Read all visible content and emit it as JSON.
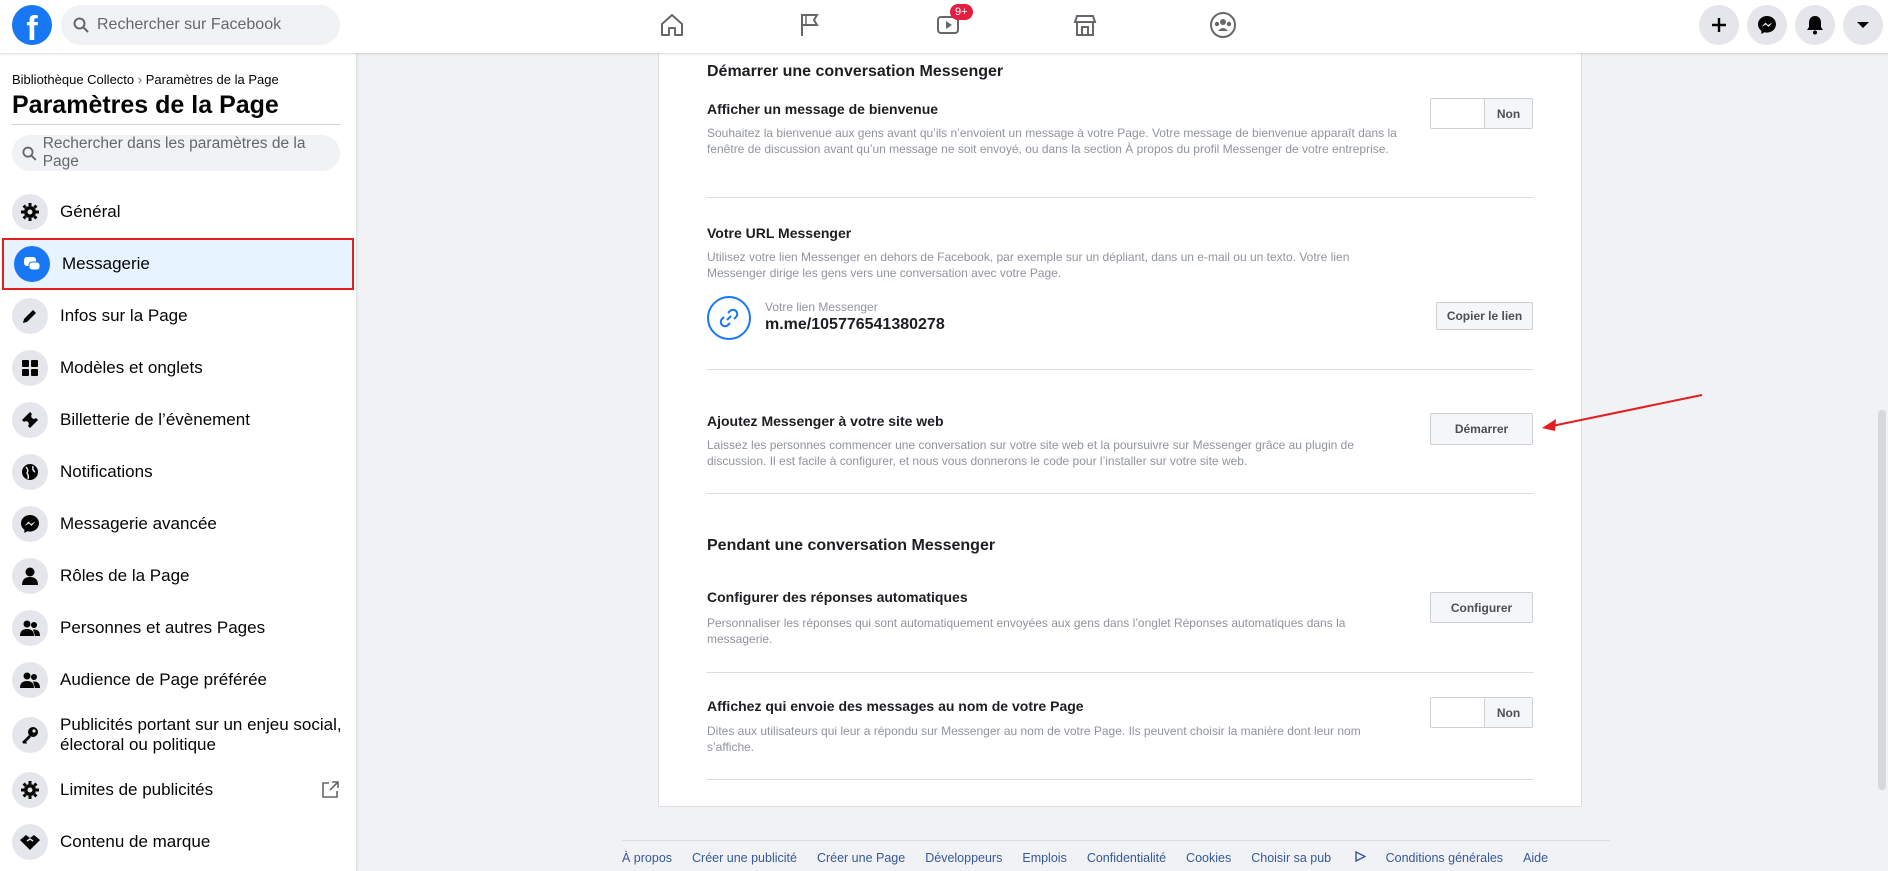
{
  "topbar": {
    "logo": "f",
    "search_placeholder": "Rechercher sur Facebook",
    "video_badge": "9+"
  },
  "sidebar": {
    "breadcrumb_page": "Bibliothèque Collecto",
    "breadcrumb_sep": "›",
    "breadcrumb_current": "Paramètres de la Page",
    "title": "Paramètres de la Page",
    "search_placeholder": "Rechercher dans les paramètres de la Page",
    "items": [
      {
        "label": "Général",
        "icon": "gear-icon"
      },
      {
        "label": "Messagerie",
        "icon": "chat-bubbles-icon",
        "active": true
      },
      {
        "label": "Infos sur la Page",
        "icon": "pencil-icon"
      },
      {
        "label": "Modèles et onglets",
        "icon": "grid-icon"
      },
      {
        "label": "Billetterie de l’évènement",
        "icon": "ticket-icon"
      },
      {
        "label": "Notifications",
        "icon": "globe-icon"
      },
      {
        "label": "Messagerie avancée",
        "icon": "messenger-icon"
      },
      {
        "label": "Rôles de la Page",
        "icon": "person-icon"
      },
      {
        "label": "Personnes et autres Pages",
        "icon": "people-icon"
      },
      {
        "label": "Audience de Page préférée",
        "icon": "people-icon"
      },
      {
        "label": "Publicités portant sur un enjeu social, électoral ou politique",
        "icon": "key-icon"
      },
      {
        "label": "Limites de publicités",
        "icon": "gear-icon"
      },
      {
        "label": "Contenu de marque",
        "icon": "handshake-icon"
      }
    ]
  },
  "main": {
    "section1_title": "Démarrer une conversation Messenger",
    "welcome": {
      "title": "Afficher un message de bienvenue",
      "desc": "Souhaitez la bienvenue aux gens avant qu’ils n’envoient un message à votre Page. Votre message de bienvenue apparaît dans la fenêtre de discussion avant qu’un message ne soit envoyé, ou dans la section À propos du profil Messenger de votre entreprise.",
      "toggle": "Non"
    },
    "url": {
      "title": "Votre URL Messenger",
      "desc": "Utilisez votre lien Messenger en dehors de Facebook, par exemple sur un dépliant, dans un e-mail ou un texto. Votre lien Messenger dirige les gens vers une conversation avec votre Page.",
      "caption": "Votre lien Messenger",
      "value": "m.me/105776541380278",
      "button": "Copier le lien"
    },
    "website": {
      "title": "Ajoutez Messenger à votre site web",
      "desc": "Laissez les personnes commencer une conversation sur votre site web et la poursuivre sur Messenger grâce au plugin de discussion. Il est facile à configurer, et nous vous donnerons le code pour l’installer sur votre site web.",
      "button": "Démarrer"
    },
    "section2_title": "Pendant une conversation Messenger",
    "auto": {
      "title": "Configurer des réponses automatiques",
      "desc": "Personnaliser les réponses qui sont automatiquement envoyées aux gens dans l’onglet Réponses automatiques dans la messagerie.",
      "button": "Configurer"
    },
    "sender": {
      "title": "Affichez qui envoie des messages au nom de votre Page",
      "desc": "Dites aux utilisateurs qui leur a répondu sur Messenger au nom de votre Page. Ils peuvent choisir la manière dont leur nom s’affiche.",
      "toggle": "Non"
    }
  },
  "footer": {
    "links": [
      "À propos",
      "Créer une publicité",
      "Créer une Page",
      "Développeurs",
      "Emplois",
      "Confidentialité",
      "Cookies",
      "Choisir sa pub",
      "Conditions générales",
      "Aide"
    ]
  },
  "colors": {
    "brand": "#1877f2",
    "highlight_outline": "#e41e1e",
    "annotation_arrow": "#e41e1e"
  }
}
